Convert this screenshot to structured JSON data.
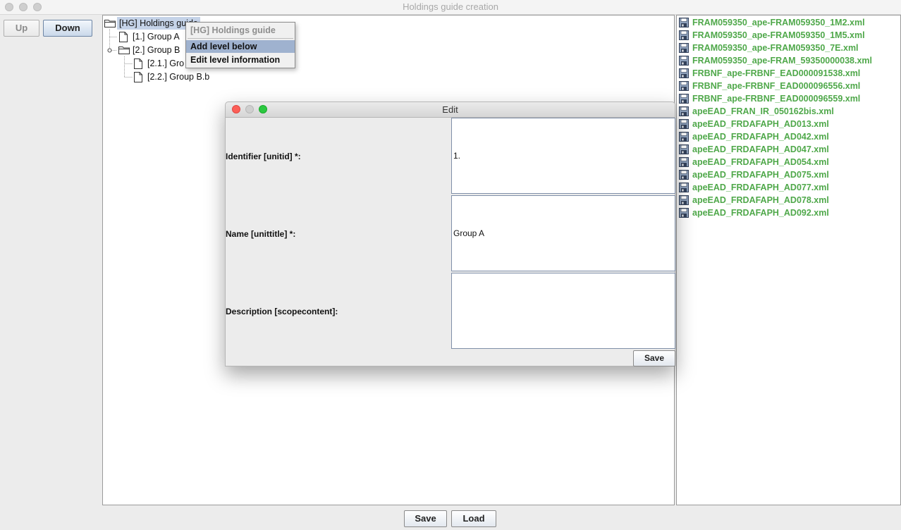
{
  "window": {
    "title": "Holdings guide creation"
  },
  "left": {
    "up_label": "Up",
    "down_label": "Down"
  },
  "tree": {
    "root": "[HG] Holdings guide",
    "nodes": [
      "[1.] Group A",
      "[2.] Group B",
      "[2.1.] Gro",
      "[2.2.] Group B.b"
    ]
  },
  "context_menu": {
    "header": "[HG] Holdings guide",
    "items": [
      "Add level below",
      "Edit level information"
    ]
  },
  "files": [
    "FRAM059350_ape-FRAM059350_1M2.xml",
    "FRAM059350_ape-FRAM059350_1M5.xml",
    "FRAM059350_ape-FRAM059350_7E.xml",
    "FRAM059350_ape-FRAM_59350000038.xml",
    "FRBNF_ape-FRBNF_EAD000091538.xml",
    "FRBNF_ape-FRBNF_EAD000096556.xml",
    "FRBNF_ape-FRBNF_EAD000096559.xml",
    "apeEAD_FRAN_IR_050162bis.xml",
    "apeEAD_FRDAFAPH_AD013.xml",
    "apeEAD_FRDAFAPH_AD042.xml",
    "apeEAD_FRDAFAPH_AD047.xml",
    "apeEAD_FRDAFAPH_AD054.xml",
    "apeEAD_FRDAFAPH_AD075.xml",
    "apeEAD_FRDAFAPH_AD077.xml",
    "apeEAD_FRDAFAPH_AD078.xml",
    "apeEAD_FRDAFAPH_AD092.xml"
  ],
  "dialog": {
    "title": "Edit",
    "identifier_label": "Identifier [unitid] *:",
    "identifier_value": "1.",
    "name_label": "Name [unittitle] *:",
    "name_value": "Group A",
    "description_label": "Description [scopecontent]:",
    "description_value": "",
    "save_label": "Save"
  },
  "bottom": {
    "save_label": "Save",
    "load_label": "Load"
  },
  "colors": {
    "file_text": "#4fa84a",
    "selection": "#c5d3e8",
    "menu_highlight": "#9fb2cf"
  }
}
